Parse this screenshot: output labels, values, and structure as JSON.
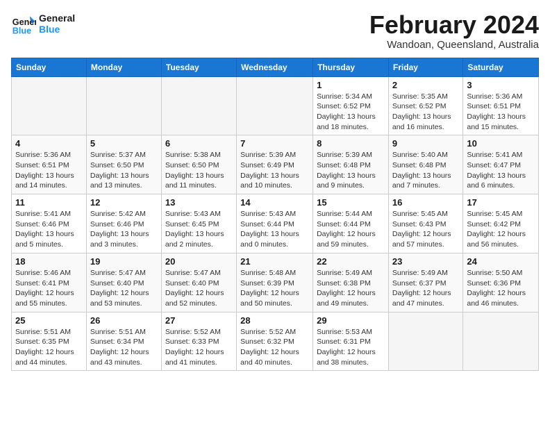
{
  "logo": {
    "line1": "General",
    "line2": "Blue"
  },
  "title": {
    "month_year": "February 2024",
    "location": "Wandoan, Queensland, Australia"
  },
  "weekdays": [
    "Sunday",
    "Monday",
    "Tuesday",
    "Wednesday",
    "Thursday",
    "Friday",
    "Saturday"
  ],
  "weeks": [
    [
      {
        "day": "",
        "info": ""
      },
      {
        "day": "",
        "info": ""
      },
      {
        "day": "",
        "info": ""
      },
      {
        "day": "",
        "info": ""
      },
      {
        "day": "1",
        "info": "Sunrise: 5:34 AM\nSunset: 6:52 PM\nDaylight: 13 hours\nand 18 minutes."
      },
      {
        "day": "2",
        "info": "Sunrise: 5:35 AM\nSunset: 6:52 PM\nDaylight: 13 hours\nand 16 minutes."
      },
      {
        "day": "3",
        "info": "Sunrise: 5:36 AM\nSunset: 6:51 PM\nDaylight: 13 hours\nand 15 minutes."
      }
    ],
    [
      {
        "day": "4",
        "info": "Sunrise: 5:36 AM\nSunset: 6:51 PM\nDaylight: 13 hours\nand 14 minutes."
      },
      {
        "day": "5",
        "info": "Sunrise: 5:37 AM\nSunset: 6:50 PM\nDaylight: 13 hours\nand 13 minutes."
      },
      {
        "day": "6",
        "info": "Sunrise: 5:38 AM\nSunset: 6:50 PM\nDaylight: 13 hours\nand 11 minutes."
      },
      {
        "day": "7",
        "info": "Sunrise: 5:39 AM\nSunset: 6:49 PM\nDaylight: 13 hours\nand 10 minutes."
      },
      {
        "day": "8",
        "info": "Sunrise: 5:39 AM\nSunset: 6:48 PM\nDaylight: 13 hours\nand 9 minutes."
      },
      {
        "day": "9",
        "info": "Sunrise: 5:40 AM\nSunset: 6:48 PM\nDaylight: 13 hours\nand 7 minutes."
      },
      {
        "day": "10",
        "info": "Sunrise: 5:41 AM\nSunset: 6:47 PM\nDaylight: 13 hours\nand 6 minutes."
      }
    ],
    [
      {
        "day": "11",
        "info": "Sunrise: 5:41 AM\nSunset: 6:46 PM\nDaylight: 13 hours\nand 5 minutes."
      },
      {
        "day": "12",
        "info": "Sunrise: 5:42 AM\nSunset: 6:46 PM\nDaylight: 13 hours\nand 3 minutes."
      },
      {
        "day": "13",
        "info": "Sunrise: 5:43 AM\nSunset: 6:45 PM\nDaylight: 13 hours\nand 2 minutes."
      },
      {
        "day": "14",
        "info": "Sunrise: 5:43 AM\nSunset: 6:44 PM\nDaylight: 13 hours\nand 0 minutes."
      },
      {
        "day": "15",
        "info": "Sunrise: 5:44 AM\nSunset: 6:44 PM\nDaylight: 12 hours\nand 59 minutes."
      },
      {
        "day": "16",
        "info": "Sunrise: 5:45 AM\nSunset: 6:43 PM\nDaylight: 12 hours\nand 57 minutes."
      },
      {
        "day": "17",
        "info": "Sunrise: 5:45 AM\nSunset: 6:42 PM\nDaylight: 12 hours\nand 56 minutes."
      }
    ],
    [
      {
        "day": "18",
        "info": "Sunrise: 5:46 AM\nSunset: 6:41 PM\nDaylight: 12 hours\nand 55 minutes."
      },
      {
        "day": "19",
        "info": "Sunrise: 5:47 AM\nSunset: 6:40 PM\nDaylight: 12 hours\nand 53 minutes."
      },
      {
        "day": "20",
        "info": "Sunrise: 5:47 AM\nSunset: 6:40 PM\nDaylight: 12 hours\nand 52 minutes."
      },
      {
        "day": "21",
        "info": "Sunrise: 5:48 AM\nSunset: 6:39 PM\nDaylight: 12 hours\nand 50 minutes."
      },
      {
        "day": "22",
        "info": "Sunrise: 5:49 AM\nSunset: 6:38 PM\nDaylight: 12 hours\nand 49 minutes."
      },
      {
        "day": "23",
        "info": "Sunrise: 5:49 AM\nSunset: 6:37 PM\nDaylight: 12 hours\nand 47 minutes."
      },
      {
        "day": "24",
        "info": "Sunrise: 5:50 AM\nSunset: 6:36 PM\nDaylight: 12 hours\nand 46 minutes."
      }
    ],
    [
      {
        "day": "25",
        "info": "Sunrise: 5:51 AM\nSunset: 6:35 PM\nDaylight: 12 hours\nand 44 minutes."
      },
      {
        "day": "26",
        "info": "Sunrise: 5:51 AM\nSunset: 6:34 PM\nDaylight: 12 hours\nand 43 minutes."
      },
      {
        "day": "27",
        "info": "Sunrise: 5:52 AM\nSunset: 6:33 PM\nDaylight: 12 hours\nand 41 minutes."
      },
      {
        "day": "28",
        "info": "Sunrise: 5:52 AM\nSunset: 6:32 PM\nDaylight: 12 hours\nand 40 minutes."
      },
      {
        "day": "29",
        "info": "Sunrise: 5:53 AM\nSunset: 6:31 PM\nDaylight: 12 hours\nand 38 minutes."
      },
      {
        "day": "",
        "info": ""
      },
      {
        "day": "",
        "info": ""
      }
    ]
  ]
}
